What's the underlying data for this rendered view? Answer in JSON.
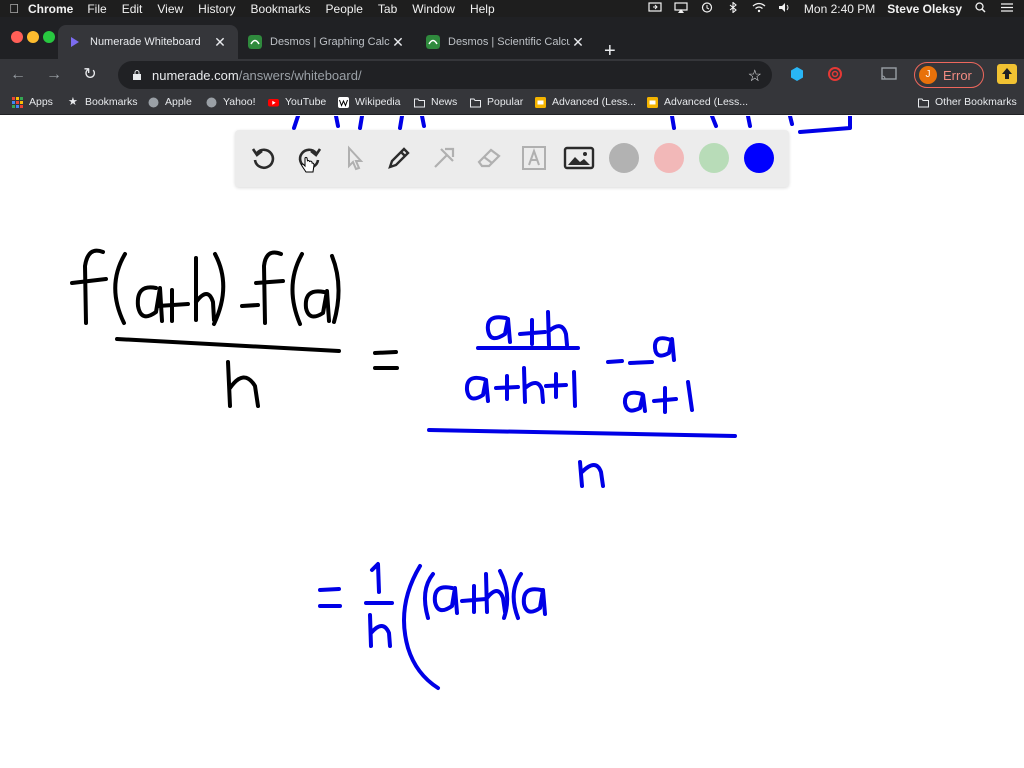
{
  "menubar": {
    "app_name": "Chrome",
    "menus": [
      "File",
      "Edit",
      "View",
      "History",
      "Bookmarks",
      "People",
      "Tab",
      "Window",
      "Help"
    ],
    "clock": "Mon 2:40 PM",
    "user": "Steve Oleksy"
  },
  "tabs": [
    {
      "label": "Numerade Whiteboard",
      "active": true,
      "favicon": "numerade-icon"
    },
    {
      "label": "Desmos | Graphing Calculato",
      "active": false,
      "favicon": "desmos-icon"
    },
    {
      "label": "Desmos | Scientific Calculato",
      "active": false,
      "favicon": "desmos-icon"
    }
  ],
  "omnibox": {
    "host": "numerade.com",
    "path": "/answers/whiteboard/"
  },
  "profile": {
    "initial": "J",
    "status": "Error"
  },
  "bookmarks": {
    "items": [
      "Apps",
      "Bookmarks",
      "Apple",
      "Yahoo!",
      "YouTube",
      "Wikipedia",
      "News",
      "Popular",
      "Advanced (Less...",
      "Advanced (Less..."
    ],
    "other": "Other Bookmarks"
  },
  "whiteboard": {
    "tools": [
      "undo-icon",
      "redo-icon",
      "select-icon",
      "pen-icon",
      "tools-icon",
      "eraser-icon",
      "text-icon",
      "image-icon"
    ],
    "colors": [
      "#b2b2b2",
      "#f2b8b8",
      "#b8dcb8",
      "#0000ff"
    ],
    "ink_colors": {
      "black": "#000000",
      "blue": "#0000e6"
    }
  }
}
